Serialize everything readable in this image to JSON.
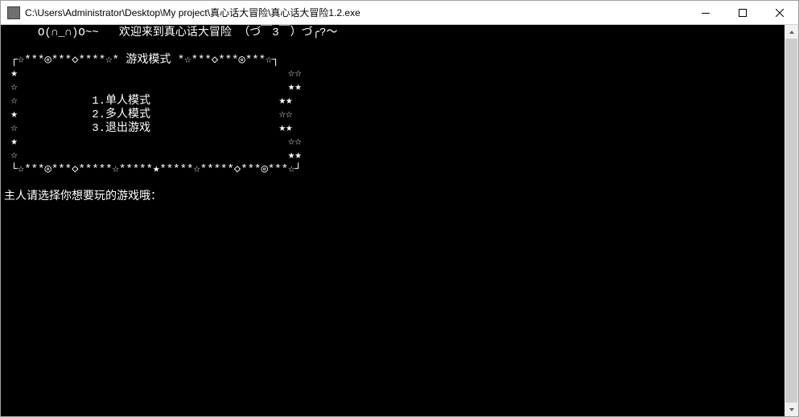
{
  "window": {
    "title": "C:\\Users\\Administrator\\Desktop\\My project\\真心话大冒险\\真心话大冒险1.2.exe"
  },
  "console": {
    "welcome": "     O(∩_∩)O~~   欢迎来到真心话大冒险 （づ￣3￣）づ╭?～",
    "box_top": " ┌☆***◎***◇****☆* 游戏模式 *☆***◇***◎***☆┐",
    "box_row_stars1": " ★                                        ☆☆",
    "box_row_stars2": " ☆                                        ★★",
    "menu1_line": " ☆           1.单人模式                   ★★",
    "menu2_line": " ★           2.多人模式                   ☆☆",
    "menu3_line": " ☆           3.退出游戏                   ★★",
    "box_row_stars3": " ★                                        ☆☆",
    "box_row_stars4": " ☆                                        ★★",
    "box_bottom": " └☆***◎***◇*****☆*****★*****☆*****◇***◎***☆┘",
    "prompt": "主人请选择你想要玩的游戏哦：",
    "menu": {
      "item1": "1.单人模式",
      "item2": "2.多人模式",
      "item3": "3.退出游戏"
    }
  }
}
